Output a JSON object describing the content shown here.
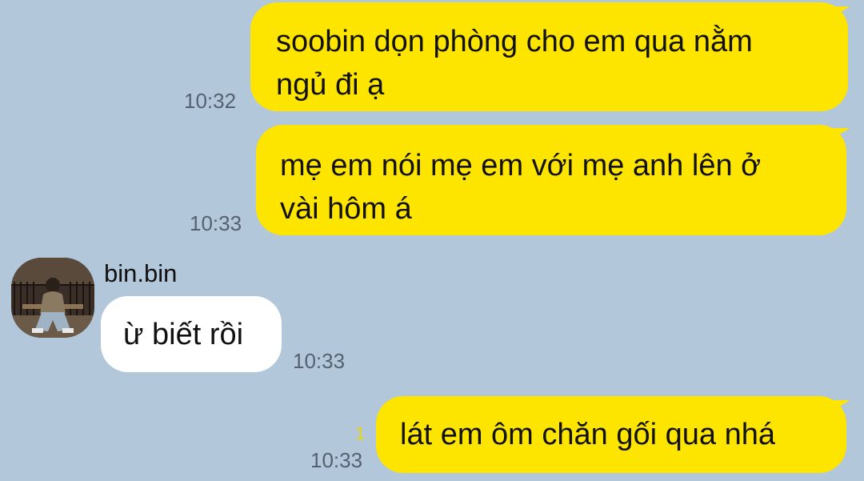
{
  "colors": {
    "background": "#b2c7da",
    "my_bubble": "#fee500",
    "their_bubble": "#ffffff",
    "timestamp": "#556170",
    "unread_count": "#e7d800"
  },
  "messages": [
    {
      "sender": "me",
      "lines": [
        "soobin dọn phòng cho em qua nằm",
        "ngủ đi ạ"
      ],
      "time": "10:32"
    },
    {
      "sender": "me",
      "lines": [
        "mẹ em nói mẹ em với mẹ anh lên ở",
        "vài hôm á"
      ],
      "time": "10:33"
    },
    {
      "sender": "bin.bin",
      "avatar_icon": "user-photo-avatar",
      "lines": [
        "ừ biết rồi"
      ],
      "time": "10:33"
    },
    {
      "sender": "me",
      "lines": [
        "lát em ôm chăn gối qua nhá"
      ],
      "unread": "1",
      "time": "10:33"
    }
  ]
}
